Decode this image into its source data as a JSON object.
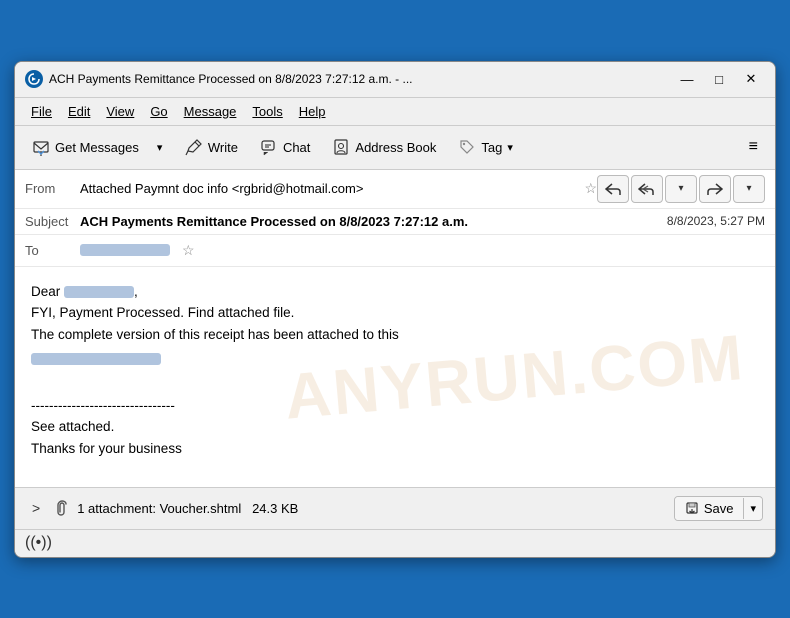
{
  "window": {
    "title": "ACH Payments Remittance Processed on 8/8/2023 7:27:12 a.m. - ...",
    "icon": "thunderbird-icon"
  },
  "title_controls": {
    "minimize": "—",
    "maximize": "□",
    "close": "✕"
  },
  "menu": {
    "items": [
      "File",
      "Edit",
      "View",
      "Go",
      "Message",
      "Tools",
      "Help"
    ]
  },
  "toolbar": {
    "get_messages_label": "Get Messages",
    "write_label": "Write",
    "chat_label": "Chat",
    "address_book_label": "Address Book",
    "tag_label": "Tag",
    "dropdown_char": "▾",
    "hamburger": "≡"
  },
  "email": {
    "from_label": "From",
    "from_value": "Attached Paymnt doc info <rgbrid@hotmail.com>",
    "subject_label": "Subject",
    "subject_value": "ACH Payments Remittance Processed on 8/8/2023 7:27:12 a.m.",
    "date_value": "8/8/2023, 5:27 PM",
    "to_label": "To",
    "to_value": ""
  },
  "body": {
    "line1": "Dear ",
    "line2": "FYI, Payment Processed. Find attached file.",
    "line3": "The complete version of this receipt has been attached to this",
    "divider": "--------------------------------",
    "line4": "See attached.",
    "line5": "Thanks for your business"
  },
  "watermark": {
    "text": "ANYRUN.COM"
  },
  "attachment": {
    "toggle": ">",
    "count_text": "1 attachment: Voucher.shtml",
    "size": "24.3 KB",
    "save_label": "Save",
    "save_dropdown": "▾"
  },
  "status_bar": {
    "wifi_symbol": "((•))"
  }
}
